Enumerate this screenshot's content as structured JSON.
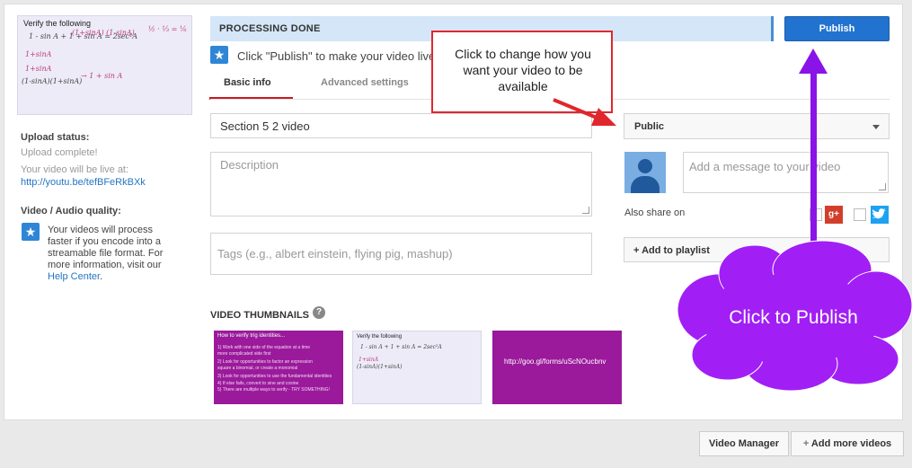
{
  "left": {
    "thumbnail": {
      "title": "Verify the following"
    },
    "upload_status_label": "Upload status:",
    "upload_status_value": "Upload complete!",
    "live_label": "Your video will be live at:",
    "live_url": "http://youtu.be/tefBFeRkBXk",
    "quality_label": "Video / Audio quality:",
    "quality_text": "Your videos will process faster if you encode into a streamable file format. For more information, visit our",
    "quality_link": "Help Center",
    "quality_end": "."
  },
  "header": {
    "status": "PROCESSING DONE",
    "publish_label": "Publish",
    "hint": "Click \"Publish\" to make your video live."
  },
  "tabs": [
    {
      "label": "Basic info",
      "active": true
    },
    {
      "label": "Advanced settings",
      "active": false
    }
  ],
  "form": {
    "title_value": "Section 5 2 video",
    "description_placeholder": "Description",
    "tags_placeholder": "Tags (e.g., albert einstein, flying pig, mashup)",
    "privacy_selected": "Public",
    "message_placeholder": "Add a message to your video",
    "also_share_label": "Also share on",
    "playlist_label": "+ Add to playlist"
  },
  "thumbnails": {
    "label": "VIDEO THUMBNAILS",
    "items": [
      {
        "title": "How to verify trig identities..."
      },
      {
        "title": "Verify the following"
      },
      {
        "title": "http://goo.gl/forms/uScNOucbnv"
      }
    ]
  },
  "bottom": {
    "video_manager_label": "Video Manager",
    "add_more_label": "Add more videos"
  },
  "annotations": {
    "callout_text": "Click to change how you want your video to be available",
    "cloud_text": "Click to Publish",
    "callout_border_color": "#e0272e",
    "arrow_color": "#8a13e8",
    "cloud_color": "#a11ff5"
  }
}
